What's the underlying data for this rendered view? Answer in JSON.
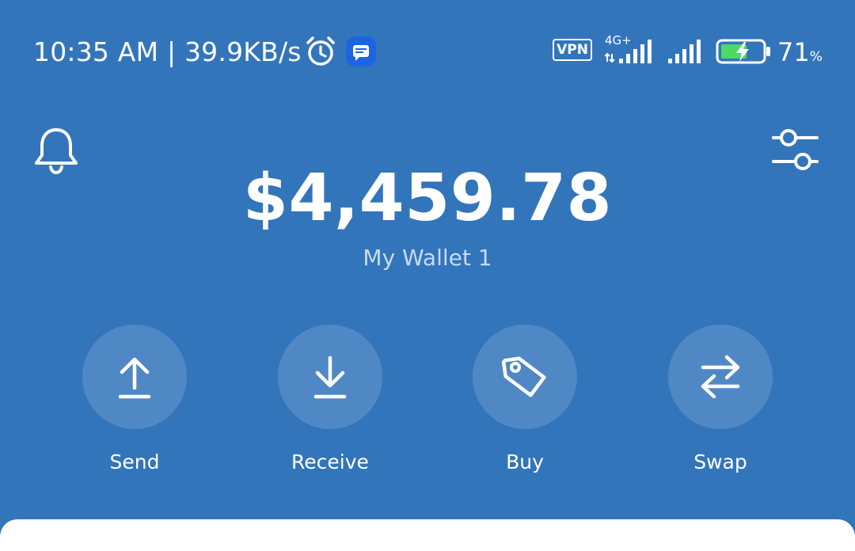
{
  "status_bar": {
    "time": "10:35 AM",
    "separator": "|",
    "network_speed": "39.9KB/s",
    "vpn_label": "VPN",
    "network_type": "4G+",
    "battery_level": "71",
    "battery_unit": "%",
    "icons": [
      "alarm-icon",
      "message-icon",
      "signal-icon",
      "battery-charging-icon"
    ]
  },
  "header": {
    "left_icon": "bell-icon",
    "right_icon": "settings-sliders-icon"
  },
  "wallet": {
    "balance": "$4,459.78",
    "name": "My Wallet 1"
  },
  "actions": [
    {
      "label": "Send",
      "icon": "upload-arrow-icon"
    },
    {
      "label": "Receive",
      "icon": "download-arrow-icon"
    },
    {
      "label": "Buy",
      "icon": "price-tag-icon"
    },
    {
      "label": "Swap",
      "icon": "swap-arrows-icon"
    }
  ],
  "colors": {
    "background": "#3375bb",
    "action_circle": "#5088c5",
    "wallet_name": "#c7dbf1",
    "battery_fill": "#4cd964",
    "sheet": "#ffffff"
  }
}
